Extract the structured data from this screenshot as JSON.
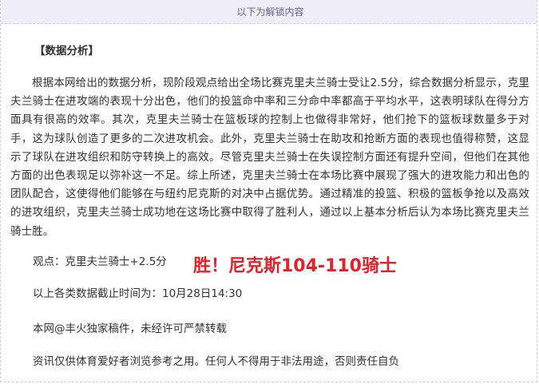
{
  "unlock_bar": {
    "text": "以下为解锁内容"
  },
  "article": {
    "section_title": "【数据分析】",
    "analysis_text": "根据本网给出的数据分析，现阶段观点给出全场比赛克里夫兰骑士受让2.5分，综合数据分析显示，克里夫兰骑士在进攻端的表现十分出色，他们的投篮命中率和三分命中率都高于平均水平，这表明球队在得分方面具有很高的效率。其次，克里夫兰骑士在篮板球的控制上也做得非常好，他们抢下的篮板球数量多于对手，这为球队创造了更多的二次进攻机会。此外，克里夫兰骑士在助攻和抢断方面的表现也值得称赞，这显示了球队在进攻组织和防守转换上的高效。尽管克里夫兰骑士在失误控制方面还有提升空间，但他们在其他方面的出色表现足以弥补这一不足。综上所述，克里夫兰骑士在本场比赛中展现了强大的进攻能力和出色的团队配合，这使得他们能够在与纽约尼克斯的对决中占据优势。通过精准的投篮、积极的篮板争抢以及高效的进攻组织，克里夫兰骑士成功地在这场比赛中取得了胜利人，通过以上基本分析后认为本场比赛克里夫兰骑士胜。",
    "viewpoint": "观点：克里夫兰骑士+2.5分",
    "result": "胜！尼克斯104-110骑士",
    "data_cutoff": "以上各类数据截止时间为：10月28日14:30",
    "copyright": "本网@丰火独家稿件，未经许可严禁转载",
    "disclaimer": "资讯仅供体育爱好者浏览参考之用。任何人不得用于非法用途，否则责任自负"
  },
  "colors": {
    "unlock_bar_bg": "#efedf8",
    "result_red": "#e3212b",
    "body_text": "#333333"
  }
}
